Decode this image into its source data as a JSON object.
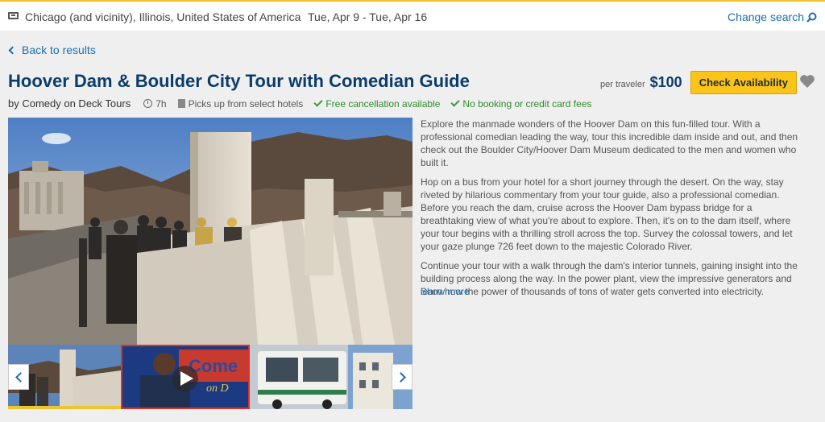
{
  "topbar": {
    "location": "Chicago (and vicinity), Illinois, United States of America",
    "dates": "Tue, Apr 9 - Tue, Apr 16",
    "change_search": "Change search"
  },
  "back_label": "Back to results",
  "title": "Hoover Dam & Boulder City Tour with Comedian Guide",
  "price": {
    "per_traveler": "per traveler",
    "amount": "$100",
    "cta": "Check Availability"
  },
  "meta": {
    "operator": "by Comedy on Deck Tours",
    "duration": "7h",
    "pickup": "Picks up from select hotels",
    "cancellation": "Free cancellation available",
    "fees": "No booking or credit card fees"
  },
  "description": [
    "Explore the manmade wonders of the Hoover Dam on this fun-filled tour. With a professional comedian leading the way, tour this incredible dam inside and out, and then check out the Boulder City/Hoover Dam Museum dedicated to the men and women who built it.",
    "Hop on a bus from your hotel for a short journey through the desert. On the way, stay riveted by hilarious commentary from your tour guide, also a professional comedian. Before you reach the dam, cruise across the Hoover Dam bypass bridge for a breathtaking view of what you're about to explore. Then, it's on to the dam itself, where your tour begins with a thrilling stroll across the top. Survey the colossal towers, and let your gaze plunge 726 feet down to the majestic Colorado River.",
    "Continue your tour with a walk through the dam's interior tunnels, gaining insight into the building process along the way. In the power plant, view the impressive generators and learn how the power of thousands of tons of water gets converted into electricity."
  ],
  "show_more": "Show more",
  "thumbnail_text": "Come",
  "thumbnail_text2": "on D",
  "colors": {
    "accent_blue": "#1a6fb0",
    "title_navy": "#0b3d6b",
    "cta_yellow": "#fcc419",
    "success_green": "#2e8b2e",
    "highlight_red": "#d9342b"
  }
}
